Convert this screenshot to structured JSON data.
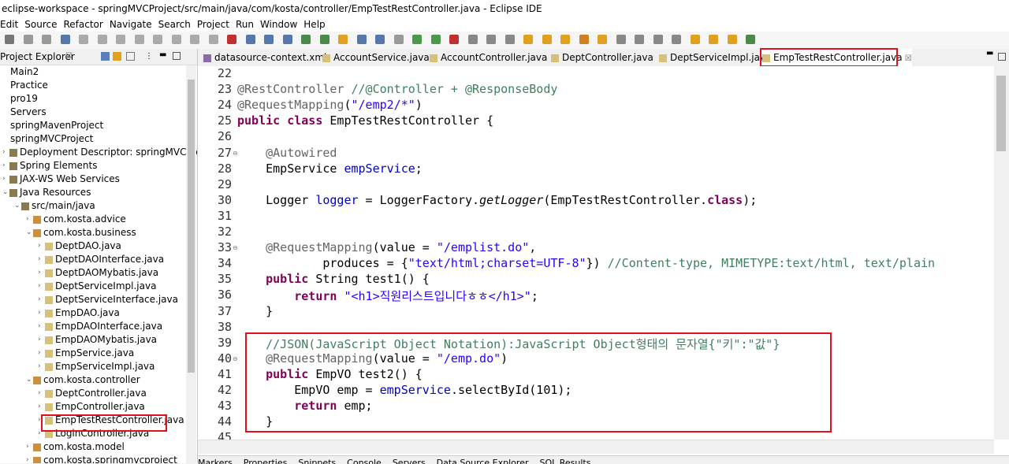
{
  "window": {
    "title": "eclipse-workspace - springMVCProject/src/main/java/com/kosta/controller/EmpTestRestController.java - Eclipse IDE"
  },
  "menu": [
    "Edit",
    "Source",
    "Refactor",
    "Navigate",
    "Search",
    "Project",
    "Run",
    "Window",
    "Help"
  ],
  "explorer": {
    "title": "Project Explorer",
    "items": [
      {
        "label": "Main2",
        "indent": 0,
        "arrow": ""
      },
      {
        "label": "Practice",
        "indent": 0,
        "arrow": ""
      },
      {
        "label": "pro19",
        "indent": 0,
        "arrow": ""
      },
      {
        "label": "Servers",
        "indent": 0,
        "arrow": ""
      },
      {
        "label": "springMavenProject",
        "indent": 0,
        "arrow": ""
      },
      {
        "label": "springMVCProject",
        "indent": 0,
        "arrow": ""
      },
      {
        "label": "Deployment Descriptor: springMVCProject",
        "indent": 1,
        "arrow": ">"
      },
      {
        "label": "Spring Elements",
        "indent": 1,
        "arrow": ">"
      },
      {
        "label": "JAX-WS Web Services",
        "indent": 1,
        "arrow": ">"
      },
      {
        "label": "Java Resources",
        "indent": 1,
        "arrow": "v"
      },
      {
        "label": "src/main/java",
        "indent": 2,
        "arrow": "v"
      },
      {
        "label": "com.kosta.advice",
        "indent": 3,
        "arrow": ">"
      },
      {
        "label": "com.kosta.business",
        "indent": 3,
        "arrow": "v"
      },
      {
        "label": "DeptDAO.java",
        "indent": 4,
        "arrow": ">"
      },
      {
        "label": "DeptDAOInterface.java",
        "indent": 4,
        "arrow": ">"
      },
      {
        "label": "DeptDAOMybatis.java",
        "indent": 4,
        "arrow": ">"
      },
      {
        "label": "DeptServiceImpl.java",
        "indent": 4,
        "arrow": ">"
      },
      {
        "label": "DeptServiceInterface.java",
        "indent": 4,
        "arrow": ">"
      },
      {
        "label": "EmpDAO.java",
        "indent": 4,
        "arrow": ">"
      },
      {
        "label": "EmpDAOInterface.java",
        "indent": 4,
        "arrow": ">"
      },
      {
        "label": "EmpDAOMybatis.java",
        "indent": 4,
        "arrow": ">"
      },
      {
        "label": "EmpService.java",
        "indent": 4,
        "arrow": ">"
      },
      {
        "label": "EmpServiceImpl.java",
        "indent": 4,
        "arrow": ">"
      },
      {
        "label": "com.kosta.controller",
        "indent": 3,
        "arrow": "v"
      },
      {
        "label": "DeptController.java",
        "indent": 4,
        "arrow": ">"
      },
      {
        "label": "EmpController.java",
        "indent": 4,
        "arrow": ">"
      },
      {
        "label": "EmpTestRestController.java",
        "indent": 4,
        "arrow": ">"
      },
      {
        "label": "LoginController.java",
        "indent": 4,
        "arrow": ">"
      },
      {
        "label": "com.kosta.model",
        "indent": 3,
        "arrow": ">"
      },
      {
        "label": "com.kosta.springmvcproject",
        "indent": 3,
        "arrow": ">"
      }
    ]
  },
  "tabs": [
    {
      "label": "datasource-context.xml"
    },
    {
      "label": "AccountService.java"
    },
    {
      "label": "AccountController.java"
    },
    {
      "label": "DeptController.java"
    },
    {
      "label": "DeptServiceImpl.java"
    },
    {
      "label": "EmpTestRestController.java"
    }
  ],
  "code": {
    "line_numbers": [
      "22",
      "23",
      "24",
      "25",
      "26",
      "27",
      "28",
      "29",
      "30",
      "31",
      "32",
      "33",
      "34",
      "35",
      "36",
      "37",
      "38",
      "39",
      "40",
      "41",
      "42",
      "43",
      "44",
      "45"
    ],
    "lines": [
      [],
      [
        {
          "t": "@RestController",
          "c": "an"
        },
        {
          "t": " //@Controller + @ResponseBody",
          "c": "cm"
        }
      ],
      [
        {
          "t": "@RequestMapping",
          "c": "an"
        },
        {
          "t": "(",
          "c": ""
        },
        {
          "t": "\"/emp2/*\"",
          "c": "st"
        },
        {
          "t": ")",
          "c": ""
        }
      ],
      [
        {
          "t": "public class",
          "c": "kw"
        },
        {
          "t": " EmpTestRestController {",
          "c": ""
        }
      ],
      [],
      [
        {
          "t": "    ",
          "c": ""
        },
        {
          "t": "@Autowired",
          "c": "an"
        }
      ],
      [
        {
          "t": "    EmpService ",
          "c": ""
        },
        {
          "t": "empService",
          "c": "fld"
        },
        {
          "t": ";",
          "c": ""
        }
      ],
      [],
      [
        {
          "t": "    Logger ",
          "c": ""
        },
        {
          "t": "logger",
          "c": "fld"
        },
        {
          "t": " = LoggerFactory.",
          "c": ""
        },
        {
          "t": "getLogger",
          "c": "it"
        },
        {
          "t": "(EmpTestRestController.",
          "c": ""
        },
        {
          "t": "class",
          "c": "kw"
        },
        {
          "t": ");",
          "c": ""
        }
      ],
      [],
      [],
      [
        {
          "t": "    ",
          "c": ""
        },
        {
          "t": "@RequestMapping",
          "c": "an"
        },
        {
          "t": "(value = ",
          "c": ""
        },
        {
          "t": "\"/emplist.do\"",
          "c": "st"
        },
        {
          "t": ",",
          "c": ""
        }
      ],
      [
        {
          "t": "            produces = {",
          "c": ""
        },
        {
          "t": "\"text/html;charset=UTF-8\"",
          "c": "st"
        },
        {
          "t": "}) ",
          "c": ""
        },
        {
          "t": "//Content-type, MIMETYPE:text/html, text/plain",
          "c": "cm"
        }
      ],
      [
        {
          "t": "    ",
          "c": ""
        },
        {
          "t": "public",
          "c": "kw"
        },
        {
          "t": " String test1() {",
          "c": ""
        }
      ],
      [
        {
          "t": "        ",
          "c": ""
        },
        {
          "t": "return",
          "c": "kw"
        },
        {
          "t": " ",
          "c": ""
        },
        {
          "t": "\"<h1>직원리스트입니다ㅎㅎ</h1>\"",
          "c": "st"
        },
        {
          "t": ";",
          "c": ""
        }
      ],
      [
        {
          "t": "    }",
          "c": ""
        }
      ],
      [],
      [
        {
          "t": "    ",
          "c": ""
        },
        {
          "t": "//JSON(JavaScript Object Notation):JavaScript Object형태의 문자열{\"키\":\"값\"}",
          "c": "cm"
        }
      ],
      [
        {
          "t": "    ",
          "c": ""
        },
        {
          "t": "@RequestMapping",
          "c": "an"
        },
        {
          "t": "(value = ",
          "c": ""
        },
        {
          "t": "\"/emp.do\"",
          "c": "st"
        },
        {
          "t": ")",
          "c": ""
        }
      ],
      [
        {
          "t": "    ",
          "c": ""
        },
        {
          "t": "public",
          "c": "kw"
        },
        {
          "t": " EmpVO test2() {",
          "c": ""
        }
      ],
      [
        {
          "t": "        EmpVO emp = ",
          "c": ""
        },
        {
          "t": "empService",
          "c": "fld"
        },
        {
          "t": ".selectById(101);",
          "c": ""
        }
      ],
      [
        {
          "t": "        ",
          "c": ""
        },
        {
          "t": "return",
          "c": "kw"
        },
        {
          "t": " emp;",
          "c": ""
        }
      ],
      [
        {
          "t": "    }",
          "c": ""
        }
      ],
      []
    ],
    "fold_lines": [
      "27",
      "33",
      "40"
    ]
  },
  "bottom_tabs": [
    "Markers",
    "Properties",
    "Snippets",
    "Console",
    "Servers",
    "Data Source Explorer",
    "SQL Results"
  ],
  "colors": {
    "highlight": "#e0101f",
    "keyword": "#7f0055",
    "string": "#2a00ff",
    "comment": "#3f7f5f",
    "field": "#0000c0",
    "annotation": "#646464"
  }
}
